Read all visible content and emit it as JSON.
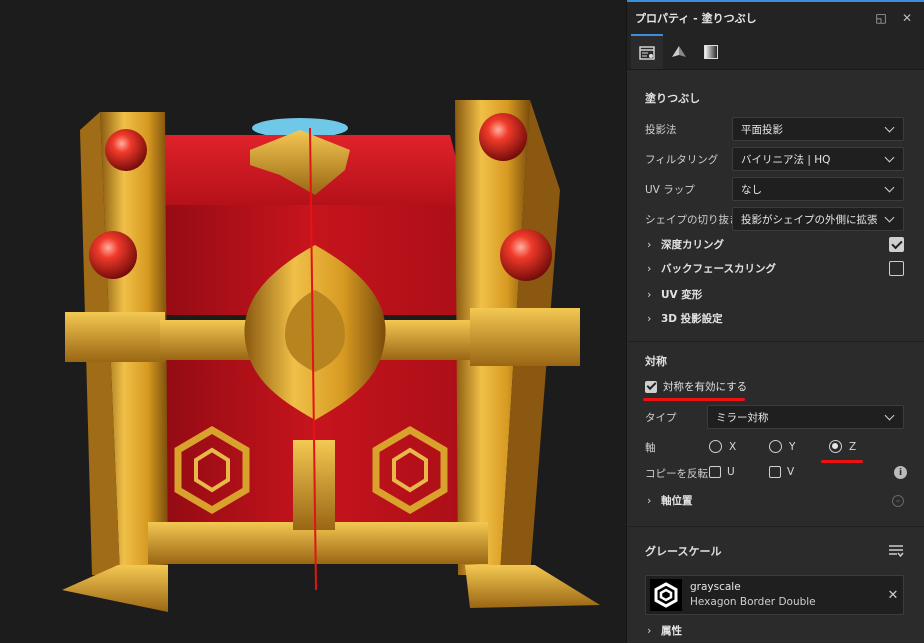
{
  "panel": {
    "title": "プロパティ - 塗りつぶし",
    "fill_section": {
      "title": "塗りつぶし",
      "rows": [
        {
          "label": "投影法",
          "value": "平面投影"
        },
        {
          "label": "フィルタリング",
          "value": "バイリニア法 | HQ"
        },
        {
          "label": "UV ラップ",
          "value": "なし"
        },
        {
          "label": "シェイプの切り抜き",
          "value": "投影がシェイプの外側に拡張"
        }
      ],
      "expanders": [
        {
          "label": "深度カリング",
          "checked": true
        },
        {
          "label": "バックフェースカリング",
          "checked": false
        },
        {
          "label": "UV 変形"
        },
        {
          "label": "3D 投影設定"
        }
      ]
    },
    "symmetry": {
      "title": "対称",
      "enable_label": "対称を有効にする",
      "enabled": true,
      "type_label": "タイプ",
      "type_value": "ミラー対称",
      "axis_label": "軸",
      "axes": [
        "X",
        "Y",
        "Z"
      ],
      "axis_selected": "Z",
      "invert_label": "コピーを反転",
      "invert_u": "U",
      "invert_v": "V",
      "axis_position_label": "軸位置"
    },
    "grayscale": {
      "title": "グレースケール",
      "texture_name": "grayscale",
      "texture_sub": "Hexagon Border Double",
      "attributes_label": "属性"
    }
  },
  "colors": {
    "accent": "#3a8fd8",
    "annotation": "#e11111",
    "gold": "#e0a82a",
    "chest_red": "#c8141e"
  }
}
